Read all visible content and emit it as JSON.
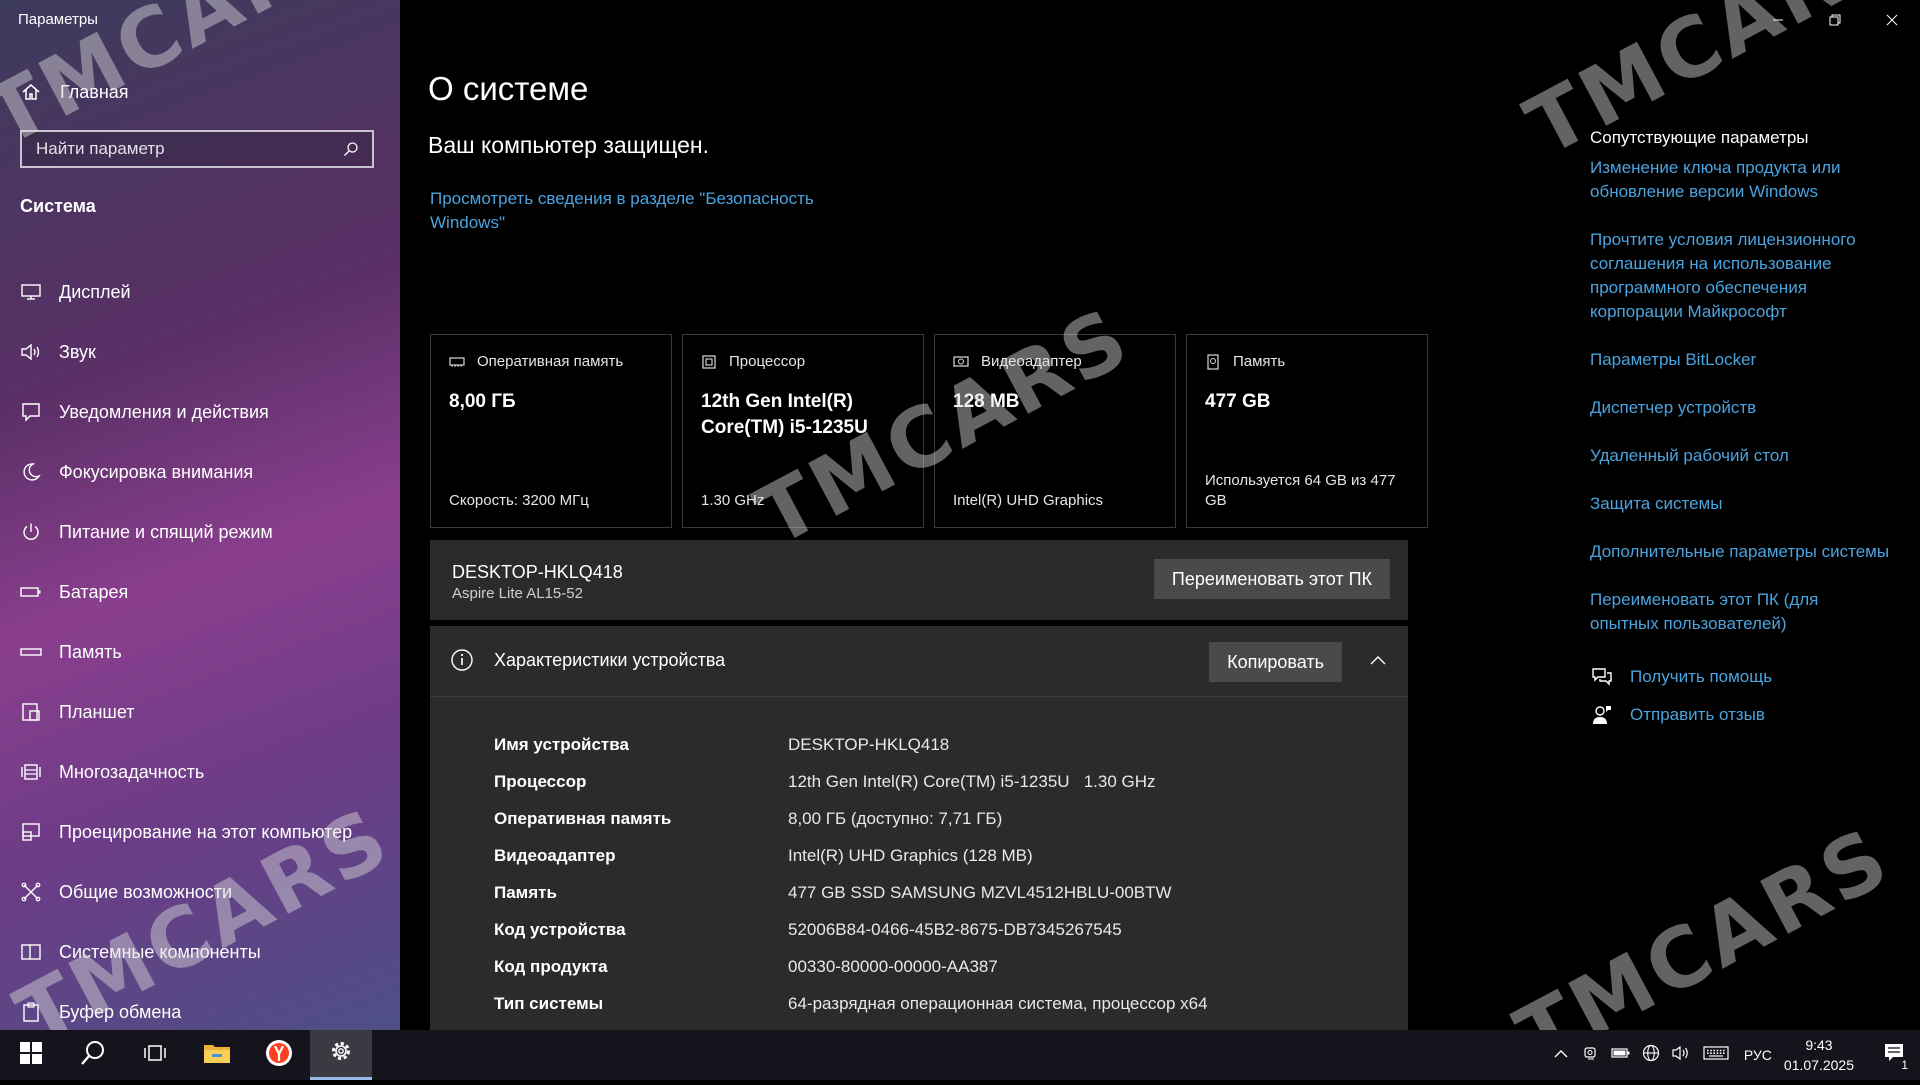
{
  "window": {
    "title": "Параметры"
  },
  "sidebar": {
    "home_label": "Главная",
    "search_placeholder": "Найти параметр",
    "section_title": "Система",
    "items": [
      {
        "label": "Дисплей",
        "icon": "display-icon"
      },
      {
        "label": "Звук",
        "icon": "sound-icon"
      },
      {
        "label": "Уведомления и действия",
        "icon": "notifications-icon"
      },
      {
        "label": "Фокусировка внимания",
        "icon": "focus-assist-icon"
      },
      {
        "label": "Питание и спящий режим",
        "icon": "power-icon"
      },
      {
        "label": "Батарея",
        "icon": "battery-icon"
      },
      {
        "label": "Память",
        "icon": "storage-icon"
      },
      {
        "label": "Планшет",
        "icon": "tablet-icon"
      },
      {
        "label": "Многозадачность",
        "icon": "multitasking-icon"
      },
      {
        "label": "Проецирование на этот компьютер",
        "icon": "projecting-icon"
      },
      {
        "label": "Общие возможности",
        "icon": "shared-experiences-icon"
      },
      {
        "label": "Системные компоненты",
        "icon": "system-components-icon"
      },
      {
        "label": "Буфер обмена",
        "icon": "clipboard-icon"
      }
    ]
  },
  "main": {
    "title": "О системе",
    "protected_text": "Ваш компьютер защищен.",
    "security_link": "Просмотреть сведения в разделе \"Безопасность Windows\"",
    "cards": [
      {
        "header": "Оперативная память",
        "value": "8,00 ГБ",
        "sub": "Скорость: 3200 МГц",
        "icon": "ram-icon"
      },
      {
        "header": "Процессор",
        "value": "12th Gen Intel(R) Core(TM) i5-1235U",
        "sub": "1.30 GHz",
        "icon": "processor-icon"
      },
      {
        "header": "Видеоадаптер",
        "value": "128 MB",
        "sub": "Intel(R) UHD Graphics",
        "icon": "gpu-icon"
      },
      {
        "header": "Память",
        "value": "477 GB",
        "sub": "Используется 64 GB из 477 GB",
        "icon": "disk-icon"
      }
    ],
    "pc": {
      "name": "DESKTOP-HKLQ418",
      "model": "Aspire Lite AL15-52",
      "rename_button": "Переименовать этот ПК"
    },
    "specs": {
      "title": "Характеристики устройства",
      "copy_button": "Копировать",
      "rows": [
        {
          "key": "Имя устройства",
          "value": "DESKTOP-HKLQ418"
        },
        {
          "key": "Процессор",
          "value": "12th Gen Intel(R) Core(TM) i5-1235U   1.30 GHz"
        },
        {
          "key": "Оперативная память",
          "value": "8,00 ГБ (доступно: 7,71 ГБ)"
        },
        {
          "key": "Видеоадаптер",
          "value": "Intel(R) UHD Graphics (128 MB)"
        },
        {
          "key": "Память",
          "value": "477 GB SSD SAMSUNG MZVL4512HBLU-00BTW"
        },
        {
          "key": "Код устройства",
          "value": "52006B84-0466-45B2-8675-DB7345267545"
        },
        {
          "key": "Код продукта",
          "value": "00330-80000-00000-AA387"
        },
        {
          "key": "Тип системы",
          "value": "64-разрядная операционная система, процессор x64"
        }
      ]
    },
    "related": {
      "title": "Сопутствующие параметры",
      "links": [
        "Изменение ключа продукта или обновление версии Windows",
        "Прочтите условия лицензионного соглашения на использование программного обеспечения корпорации Майкрософт",
        "Параметры BitLocker",
        "Диспетчер устройств",
        "Удаленный рабочий стол",
        "Защита системы",
        "Дополнительные параметры системы",
        "Переименовать этот ПК (для опытных пользователей)"
      ],
      "help": "Получить помощь",
      "feedback": "Отправить отзыв"
    }
  },
  "watermark": "TMCARS",
  "taskbar": {
    "apps": [
      "start-icon",
      "search-icon",
      "task-view-icon",
      "file-explorer-icon",
      "yandex-browser-icon",
      "settings-icon"
    ],
    "language": "РУС",
    "time": "9:43",
    "date": "01.07.2025",
    "notification_count": "1"
  },
  "colors": {
    "link": "#4aa3df",
    "card_bg": "#000000",
    "panel_bg": "#2b2b2b",
    "button_bg": "#4a4a4a"
  }
}
